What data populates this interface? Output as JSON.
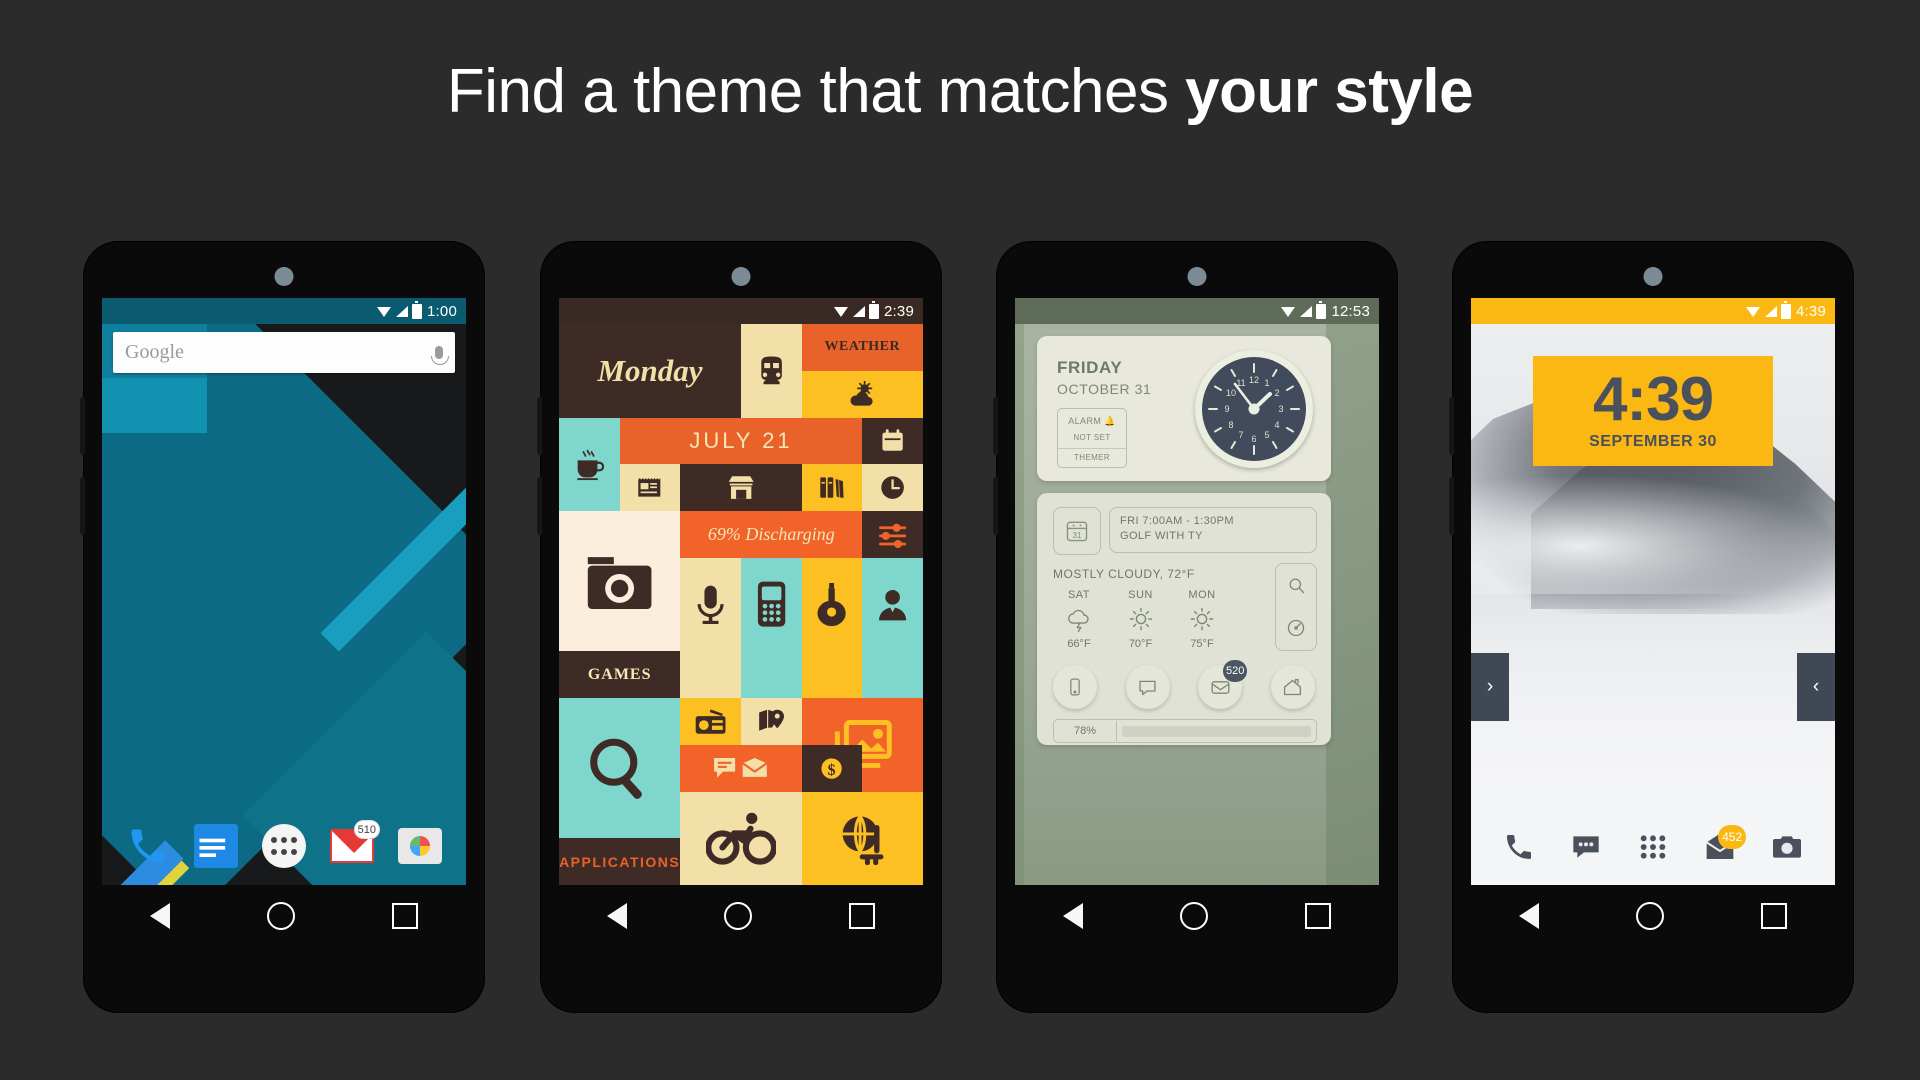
{
  "headline": {
    "plain": "Find a theme that matches ",
    "bold": "your style"
  },
  "phones": [
    {
      "id": "material",
      "statusbar": {
        "time": "1:00",
        "bg": "#0a5a70"
      },
      "search": {
        "text": "Google",
        "mic_icon": "microphone-icon"
      },
      "dock": [
        {
          "name": "phone-icon",
          "label": "Phone",
          "badge": null
        },
        {
          "name": "messages-icon",
          "label": "Messages",
          "badge": null
        },
        {
          "name": "app-drawer-icon",
          "label": "Apps",
          "badge": null
        },
        {
          "name": "gmail-icon",
          "label": "Gmail",
          "badge": "510"
        },
        {
          "name": "camera-icon",
          "label": "Camera",
          "badge": null
        }
      ],
      "nav": [
        "back-button",
        "home-button",
        "recents-button"
      ]
    },
    {
      "id": "retro-tiles",
      "statusbar": {
        "time": "2:39",
        "bg": "#3a2a24"
      },
      "tiles": {
        "monday": "Monday",
        "weather": "WEATHER",
        "july": "JULY 21",
        "battery": "69% Discharging",
        "games": "GAMES",
        "applications": "APPLICATIONS"
      },
      "icons": [
        "train-icon",
        "sun-cloud-icon",
        "coffee-icon",
        "calendar-icon",
        "news-icon",
        "store-icon",
        "books-icon",
        "clock-icon",
        "camera-icon",
        "settings-sliders-icon",
        "microphone-icon",
        "mobile-phone-icon",
        "guitar-icon",
        "contact-icon",
        "search-icon",
        "radio-icon",
        "map-pin-icon",
        "photos-icon",
        "chat-icon",
        "mail-icon",
        "money-icon",
        "bike-icon",
        "globe-icon"
      ]
    },
    {
      "id": "sage",
      "statusbar": {
        "time": "12:53",
        "bg": "#5e6b59"
      },
      "clock_card": {
        "day": "FRIDAY",
        "date": "OCTOBER 31",
        "alarm_label": "ALARM",
        "alarm_value": "NOT SET",
        "themer": "THEMER",
        "analog_time": "1:53"
      },
      "event": {
        "time": "FRI 7:00AM - 1:30PM",
        "title": "GOLF WITH TY",
        "day_number": "31"
      },
      "weather": {
        "current": "MOSTLY CLOUDY, 72°F",
        "forecast": [
          {
            "day": "SAT",
            "icon": "storm-icon",
            "temp": "66°F"
          },
          {
            "day": "SUN",
            "icon": "sun-icon",
            "temp": "70°F"
          },
          {
            "day": "MON",
            "icon": "sun-icon",
            "temp": "75°F"
          }
        ]
      },
      "side_buttons": [
        "search-icon",
        "compass-icon"
      ],
      "dock": [
        {
          "name": "phone-icon",
          "badge": null
        },
        {
          "name": "chat-icon",
          "badge": null
        },
        {
          "name": "mail-icon",
          "badge": "520"
        },
        {
          "name": "home-icon",
          "badge": null
        }
      ],
      "battery": {
        "percent": "78%",
        "value": 78
      }
    },
    {
      "id": "yellow-mountain",
      "statusbar": {
        "time": "4:39",
        "bg": "#fcb812"
      },
      "clock_widget": {
        "time": "4:39",
        "date": "SEPTEMBER 30",
        "bg": "#fcb812"
      },
      "page_tabs": {
        "left": "›",
        "right": "‹"
      },
      "dock": [
        {
          "name": "phone-icon",
          "badge": null
        },
        {
          "name": "chat-icon",
          "badge": null
        },
        {
          "name": "app-drawer-icon",
          "badge": null
        },
        {
          "name": "mail-icon",
          "badge": "452"
        },
        {
          "name": "camera-icon",
          "badge": null
        }
      ]
    }
  ]
}
